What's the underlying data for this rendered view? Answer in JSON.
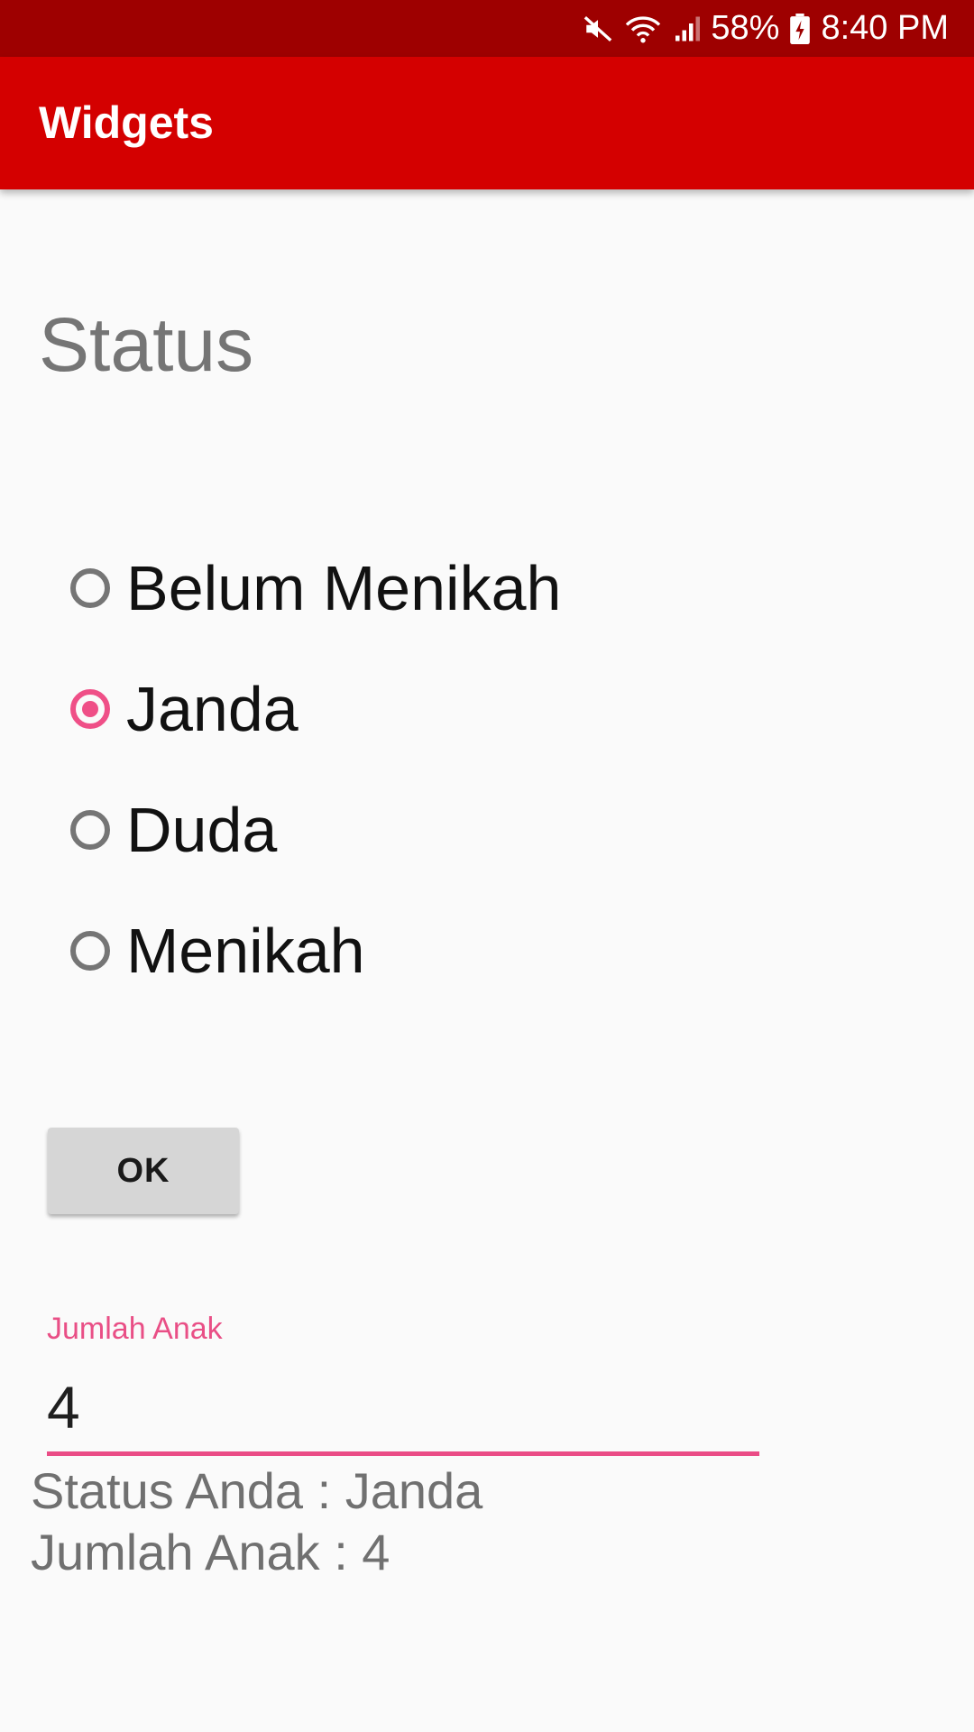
{
  "status_bar": {
    "battery": "58%",
    "time": "8:40 PM",
    "icons": [
      "mute-icon",
      "wifi-icon",
      "signal-icon",
      "battery-icon"
    ]
  },
  "app_bar": {
    "title": "Widgets"
  },
  "form": {
    "heading": "Status",
    "radios": [
      {
        "label": "Belum Menikah",
        "checked": false
      },
      {
        "label": "Janda",
        "checked": true
      },
      {
        "label": "Duda",
        "checked": false
      },
      {
        "label": "Menikah",
        "checked": false
      }
    ],
    "ok_label": "OK",
    "children_field": {
      "label": "Jumlah Anak",
      "value": "4"
    },
    "result": {
      "status_line": "Status Anda : Janda",
      "children_line": "Jumlah Anak : 4"
    }
  },
  "colors": {
    "status_bar": "#9e0000",
    "app_bar": "#d40000",
    "accent": "#ef4f87",
    "background": "#fafafa"
  }
}
